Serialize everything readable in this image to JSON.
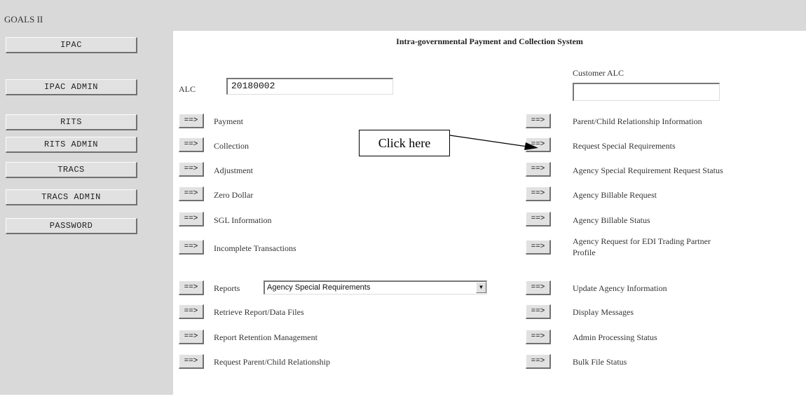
{
  "app": {
    "title": "GOALS II"
  },
  "sidebar": {
    "items": [
      {
        "label": "IPAC"
      },
      {
        "label": "IPAC ADMIN"
      },
      {
        "label": "RITS"
      },
      {
        "label": "RITS ADMIN"
      },
      {
        "label": "TRACS"
      },
      {
        "label": "TRACS ADMIN"
      },
      {
        "label": "PASSWORD"
      }
    ]
  },
  "main": {
    "title": "Intra-governmental Payment and Collection System",
    "alc_label": "ALC",
    "alc_value": "20180002",
    "customer_alc_label": "Customer ALC",
    "customer_alc_value": "",
    "arrow_label": "==>",
    "left_items": [
      {
        "label": "Payment"
      },
      {
        "label": "Collection"
      },
      {
        "label": "Adjustment"
      },
      {
        "label": "Zero Dollar"
      },
      {
        "label": "SGL Information"
      },
      {
        "label": "Incomplete Transactions"
      },
      {
        "label": "Reports"
      },
      {
        "label": "Retrieve Report/Data Files"
      },
      {
        "label": "Report Retention Management"
      },
      {
        "label": "Request Parent/Child Relationship"
      }
    ],
    "reports_select": {
      "selected": "Agency Special Requirements"
    },
    "right_items": [
      {
        "label": "Parent/Child Relationship Information"
      },
      {
        "label": "Request Special Requirements"
      },
      {
        "label": "Agency Special Requirement Request Status"
      },
      {
        "label": "Agency Billable Request"
      },
      {
        "label": "Agency Billable Status"
      },
      {
        "label": "Agency Request for EDI Trading Partner"
      },
      {
        "label": "Update Agency Information"
      },
      {
        "label": "Display Messages"
      },
      {
        "label": "Admin Processing Status"
      },
      {
        "label": "Bulk File Status"
      }
    ],
    "right_item_5_line2": "Profile"
  },
  "annotation": {
    "callout_text": "Click here"
  }
}
